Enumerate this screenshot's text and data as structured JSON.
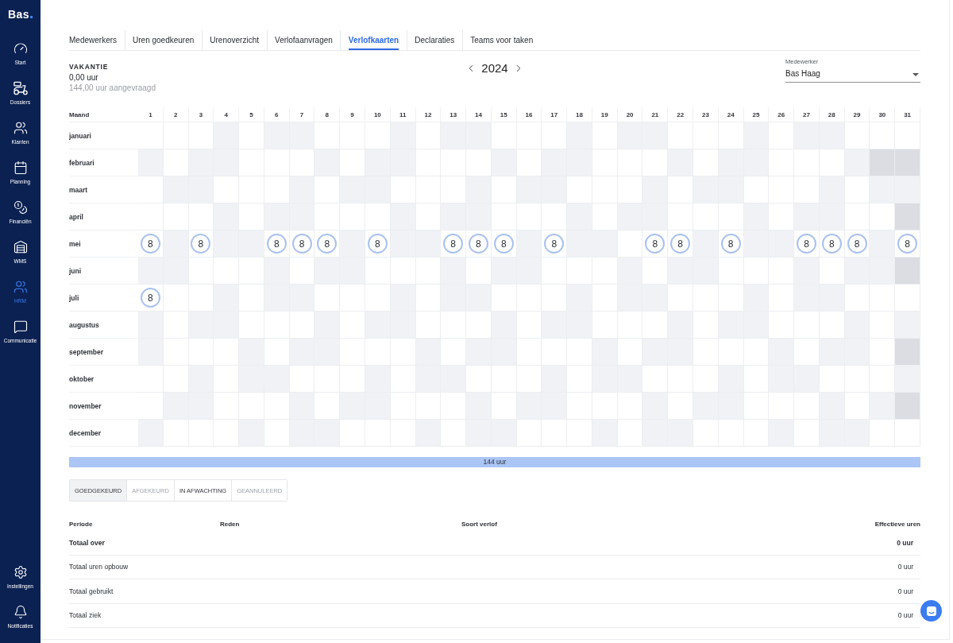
{
  "sidebar": {
    "logo": "Bas",
    "items": [
      {
        "label": "Start",
        "selected": false
      },
      {
        "label": "Dossiers",
        "selected": false
      },
      {
        "label": "Klanten",
        "selected": false
      },
      {
        "label": "Planning",
        "selected": false
      },
      {
        "label": "Financiën",
        "selected": false
      },
      {
        "label": "WMS",
        "selected": false
      },
      {
        "label": "HRM",
        "selected": true
      },
      {
        "label": "Communicatie",
        "selected": false
      }
    ],
    "bottom_items": [
      {
        "label": "Instellingen",
        "selected": false
      },
      {
        "label": "Notificaties",
        "selected": false
      }
    ]
  },
  "tabs": [
    {
      "label": "Medewerkers",
      "selected": false
    },
    {
      "label": "Uren goedkeuren",
      "selected": false
    },
    {
      "label": "Urenoverzicht",
      "selected": false
    },
    {
      "label": "Verlofaanvragen",
      "selected": false
    },
    {
      "label": "Verlofkaarten",
      "selected": true
    },
    {
      "label": "Declaraties",
      "selected": false
    },
    {
      "label": "Teams voor taken",
      "selected": false
    }
  ],
  "balance": {
    "title": "VAKANTIE",
    "hours": "0,00 uur",
    "requested": "144,00 uur aangevraagd"
  },
  "year_nav": {
    "year": "2024"
  },
  "employee_select": {
    "label": "Medewerker",
    "value": "Bas Haag"
  },
  "calendar": {
    "month_header": "Maand",
    "day_headers": [
      "1",
      "2",
      "3",
      "4",
      "5",
      "6",
      "7",
      "8",
      "9",
      "10",
      "11",
      "12",
      "13",
      "14",
      "15",
      "16",
      "17",
      "18",
      "19",
      "20",
      "21",
      "22",
      "23",
      "24",
      "25",
      "26",
      "27",
      "28",
      "29",
      "30",
      "31"
    ],
    "months": [
      {
        "name": "januari",
        "days": [
          {
            "kind": "work"
          },
          {
            "kind": "work"
          },
          {
            "kind": "work"
          },
          {
            "kind": "off"
          },
          {
            "kind": "work"
          },
          {
            "kind": "off"
          },
          {
            "kind": "off"
          },
          {
            "kind": "work"
          },
          {
            "kind": "work"
          },
          {
            "kind": "work"
          },
          {
            "kind": "off"
          },
          {
            "kind": "work"
          },
          {
            "kind": "off"
          },
          {
            "kind": "off"
          },
          {
            "kind": "work"
          },
          {
            "kind": "work"
          },
          {
            "kind": "work"
          },
          {
            "kind": "off"
          },
          {
            "kind": "work"
          },
          {
            "kind": "off"
          },
          {
            "kind": "off"
          },
          {
            "kind": "work"
          },
          {
            "kind": "work"
          },
          {
            "kind": "work"
          },
          {
            "kind": "off"
          },
          {
            "kind": "work"
          },
          {
            "kind": "off"
          },
          {
            "kind": "off"
          },
          {
            "kind": "work"
          },
          {
            "kind": "work"
          },
          {
            "kind": "work"
          }
        ]
      },
      {
        "name": "februari",
        "days": [
          {
            "kind": "off"
          },
          {
            "kind": "work"
          },
          {
            "kind": "off"
          },
          {
            "kind": "off"
          },
          {
            "kind": "work"
          },
          {
            "kind": "work"
          },
          {
            "kind": "work"
          },
          {
            "kind": "off"
          },
          {
            "kind": "work"
          },
          {
            "kind": "off"
          },
          {
            "kind": "off"
          },
          {
            "kind": "work"
          },
          {
            "kind": "work"
          },
          {
            "kind": "work"
          },
          {
            "kind": "off"
          },
          {
            "kind": "work"
          },
          {
            "kind": "off"
          },
          {
            "kind": "off"
          },
          {
            "kind": "work"
          },
          {
            "kind": "work"
          },
          {
            "kind": "work"
          },
          {
            "kind": "off"
          },
          {
            "kind": "work"
          },
          {
            "kind": "off"
          },
          {
            "kind": "off"
          },
          {
            "kind": "work"
          },
          {
            "kind": "work"
          },
          {
            "kind": "work"
          },
          {
            "kind": "off"
          },
          {
            "kind": "none"
          },
          {
            "kind": "none"
          }
        ]
      },
      {
        "name": "maart",
        "days": [
          {
            "kind": "work"
          },
          {
            "kind": "off"
          },
          {
            "kind": "off"
          },
          {
            "kind": "work"
          },
          {
            "kind": "work"
          },
          {
            "kind": "work"
          },
          {
            "kind": "off"
          },
          {
            "kind": "work"
          },
          {
            "kind": "off"
          },
          {
            "kind": "off"
          },
          {
            "kind": "work"
          },
          {
            "kind": "work"
          },
          {
            "kind": "work"
          },
          {
            "kind": "off"
          },
          {
            "kind": "work"
          },
          {
            "kind": "off"
          },
          {
            "kind": "off"
          },
          {
            "kind": "work"
          },
          {
            "kind": "work"
          },
          {
            "kind": "work"
          },
          {
            "kind": "off"
          },
          {
            "kind": "work"
          },
          {
            "kind": "off"
          },
          {
            "kind": "off"
          },
          {
            "kind": "work"
          },
          {
            "kind": "work"
          },
          {
            "kind": "work"
          },
          {
            "kind": "off"
          },
          {
            "kind": "work"
          },
          {
            "kind": "off"
          },
          {
            "kind": "off"
          }
        ]
      },
      {
        "name": "april",
        "days": [
          {
            "kind": "work"
          },
          {
            "kind": "work"
          },
          {
            "kind": "work"
          },
          {
            "kind": "off"
          },
          {
            "kind": "work"
          },
          {
            "kind": "off"
          },
          {
            "kind": "off"
          },
          {
            "kind": "work"
          },
          {
            "kind": "work"
          },
          {
            "kind": "work"
          },
          {
            "kind": "off"
          },
          {
            "kind": "work"
          },
          {
            "kind": "off"
          },
          {
            "kind": "off"
          },
          {
            "kind": "work"
          },
          {
            "kind": "work"
          },
          {
            "kind": "work"
          },
          {
            "kind": "off"
          },
          {
            "kind": "work"
          },
          {
            "kind": "off"
          },
          {
            "kind": "off"
          },
          {
            "kind": "work"
          },
          {
            "kind": "work"
          },
          {
            "kind": "work"
          },
          {
            "kind": "off"
          },
          {
            "kind": "work"
          },
          {
            "kind": "off"
          },
          {
            "kind": "off"
          },
          {
            "kind": "work"
          },
          {
            "kind": "work"
          },
          {
            "kind": "none"
          }
        ]
      },
      {
        "name": "mei",
        "days": [
          {
            "kind": "work",
            "hours": "8"
          },
          {
            "kind": "off"
          },
          {
            "kind": "work",
            "hours": "8"
          },
          {
            "kind": "off"
          },
          {
            "kind": "off"
          },
          {
            "kind": "work",
            "hours": "8"
          },
          {
            "kind": "work",
            "hours": "8"
          },
          {
            "kind": "work",
            "hours": "8"
          },
          {
            "kind": "off"
          },
          {
            "kind": "work",
            "hours": "8"
          },
          {
            "kind": "off"
          },
          {
            "kind": "off"
          },
          {
            "kind": "work",
            "hours": "8"
          },
          {
            "kind": "work",
            "hours": "8"
          },
          {
            "kind": "work",
            "hours": "8"
          },
          {
            "kind": "off"
          },
          {
            "kind": "work",
            "hours": "8"
          },
          {
            "kind": "off"
          },
          {
            "kind": "off"
          },
          {
            "kind": "work"
          },
          {
            "kind": "work",
            "hours": "8"
          },
          {
            "kind": "work",
            "hours": "8"
          },
          {
            "kind": "off"
          },
          {
            "kind": "work",
            "hours": "8"
          },
          {
            "kind": "off"
          },
          {
            "kind": "off"
          },
          {
            "kind": "work",
            "hours": "8"
          },
          {
            "kind": "work",
            "hours": "8"
          },
          {
            "kind": "work",
            "hours": "8"
          },
          {
            "kind": "off"
          },
          {
            "kind": "work",
            "hours": "8"
          }
        ]
      },
      {
        "name": "juni",
        "days": [
          {
            "kind": "off"
          },
          {
            "kind": "off"
          },
          {
            "kind": "work"
          },
          {
            "kind": "work"
          },
          {
            "kind": "work"
          },
          {
            "kind": "off"
          },
          {
            "kind": "work"
          },
          {
            "kind": "off"
          },
          {
            "kind": "off"
          },
          {
            "kind": "work"
          },
          {
            "kind": "work"
          },
          {
            "kind": "work"
          },
          {
            "kind": "off"
          },
          {
            "kind": "work"
          },
          {
            "kind": "off"
          },
          {
            "kind": "off"
          },
          {
            "kind": "work"
          },
          {
            "kind": "work"
          },
          {
            "kind": "work"
          },
          {
            "kind": "off"
          },
          {
            "kind": "work"
          },
          {
            "kind": "off"
          },
          {
            "kind": "off"
          },
          {
            "kind": "work"
          },
          {
            "kind": "work"
          },
          {
            "kind": "work"
          },
          {
            "kind": "off"
          },
          {
            "kind": "work"
          },
          {
            "kind": "off"
          },
          {
            "kind": "off"
          },
          {
            "kind": "none"
          }
        ]
      },
      {
        "name": "juli",
        "days": [
          {
            "kind": "work",
            "hours": "8"
          },
          {
            "kind": "work"
          },
          {
            "kind": "work"
          },
          {
            "kind": "off"
          },
          {
            "kind": "work"
          },
          {
            "kind": "off"
          },
          {
            "kind": "off"
          },
          {
            "kind": "work"
          },
          {
            "kind": "work"
          },
          {
            "kind": "work"
          },
          {
            "kind": "off"
          },
          {
            "kind": "work"
          },
          {
            "kind": "off"
          },
          {
            "kind": "off"
          },
          {
            "kind": "work"
          },
          {
            "kind": "work"
          },
          {
            "kind": "work"
          },
          {
            "kind": "off"
          },
          {
            "kind": "work"
          },
          {
            "kind": "off"
          },
          {
            "kind": "off"
          },
          {
            "kind": "work"
          },
          {
            "kind": "work"
          },
          {
            "kind": "work"
          },
          {
            "kind": "off"
          },
          {
            "kind": "work"
          },
          {
            "kind": "off"
          },
          {
            "kind": "off"
          },
          {
            "kind": "work"
          },
          {
            "kind": "work"
          },
          {
            "kind": "work"
          }
        ]
      },
      {
        "name": "augustus",
        "days": [
          {
            "kind": "off"
          },
          {
            "kind": "work"
          },
          {
            "kind": "off"
          },
          {
            "kind": "off"
          },
          {
            "kind": "work"
          },
          {
            "kind": "work"
          },
          {
            "kind": "work"
          },
          {
            "kind": "off"
          },
          {
            "kind": "work"
          },
          {
            "kind": "off"
          },
          {
            "kind": "off"
          },
          {
            "kind": "work"
          },
          {
            "kind": "work"
          },
          {
            "kind": "work"
          },
          {
            "kind": "off"
          },
          {
            "kind": "work"
          },
          {
            "kind": "off"
          },
          {
            "kind": "off"
          },
          {
            "kind": "work"
          },
          {
            "kind": "work"
          },
          {
            "kind": "work"
          },
          {
            "kind": "off"
          },
          {
            "kind": "work"
          },
          {
            "kind": "off"
          },
          {
            "kind": "off"
          },
          {
            "kind": "work"
          },
          {
            "kind": "work"
          },
          {
            "kind": "work"
          },
          {
            "kind": "off"
          },
          {
            "kind": "work"
          },
          {
            "kind": "off"
          }
        ]
      },
      {
        "name": "september",
        "days": [
          {
            "kind": "off"
          },
          {
            "kind": "work"
          },
          {
            "kind": "work"
          },
          {
            "kind": "work"
          },
          {
            "kind": "off"
          },
          {
            "kind": "work"
          },
          {
            "kind": "off"
          },
          {
            "kind": "off"
          },
          {
            "kind": "work"
          },
          {
            "kind": "work"
          },
          {
            "kind": "work"
          },
          {
            "kind": "off"
          },
          {
            "kind": "work"
          },
          {
            "kind": "off"
          },
          {
            "kind": "off"
          },
          {
            "kind": "work"
          },
          {
            "kind": "work"
          },
          {
            "kind": "work"
          },
          {
            "kind": "off"
          },
          {
            "kind": "work"
          },
          {
            "kind": "off"
          },
          {
            "kind": "off"
          },
          {
            "kind": "work"
          },
          {
            "kind": "work"
          },
          {
            "kind": "work"
          },
          {
            "kind": "off"
          },
          {
            "kind": "work"
          },
          {
            "kind": "off"
          },
          {
            "kind": "off"
          },
          {
            "kind": "work"
          },
          {
            "kind": "none"
          }
        ]
      },
      {
        "name": "oktober",
        "days": [
          {
            "kind": "work"
          },
          {
            "kind": "work"
          },
          {
            "kind": "off"
          },
          {
            "kind": "work"
          },
          {
            "kind": "off"
          },
          {
            "kind": "off"
          },
          {
            "kind": "work"
          },
          {
            "kind": "work"
          },
          {
            "kind": "work"
          },
          {
            "kind": "off"
          },
          {
            "kind": "work"
          },
          {
            "kind": "off"
          },
          {
            "kind": "off"
          },
          {
            "kind": "work"
          },
          {
            "kind": "work"
          },
          {
            "kind": "work"
          },
          {
            "kind": "off"
          },
          {
            "kind": "work"
          },
          {
            "kind": "off"
          },
          {
            "kind": "off"
          },
          {
            "kind": "work"
          },
          {
            "kind": "work"
          },
          {
            "kind": "work"
          },
          {
            "kind": "off"
          },
          {
            "kind": "work"
          },
          {
            "kind": "off"
          },
          {
            "kind": "off"
          },
          {
            "kind": "work"
          },
          {
            "kind": "work"
          },
          {
            "kind": "work"
          },
          {
            "kind": "off"
          }
        ]
      },
      {
        "name": "november",
        "days": [
          {
            "kind": "work"
          },
          {
            "kind": "off"
          },
          {
            "kind": "off"
          },
          {
            "kind": "work"
          },
          {
            "kind": "work"
          },
          {
            "kind": "work"
          },
          {
            "kind": "off"
          },
          {
            "kind": "work"
          },
          {
            "kind": "off"
          },
          {
            "kind": "off"
          },
          {
            "kind": "work"
          },
          {
            "kind": "work"
          },
          {
            "kind": "work"
          },
          {
            "kind": "off"
          },
          {
            "kind": "work"
          },
          {
            "kind": "off"
          },
          {
            "kind": "off"
          },
          {
            "kind": "work"
          },
          {
            "kind": "work"
          },
          {
            "kind": "work"
          },
          {
            "kind": "off"
          },
          {
            "kind": "work"
          },
          {
            "kind": "off"
          },
          {
            "kind": "off"
          },
          {
            "kind": "work"
          },
          {
            "kind": "work"
          },
          {
            "kind": "work"
          },
          {
            "kind": "off"
          },
          {
            "kind": "work"
          },
          {
            "kind": "off"
          },
          {
            "kind": "none"
          }
        ]
      },
      {
        "name": "december",
        "days": [
          {
            "kind": "off"
          },
          {
            "kind": "work"
          },
          {
            "kind": "work"
          },
          {
            "kind": "work"
          },
          {
            "kind": "off"
          },
          {
            "kind": "work"
          },
          {
            "kind": "off"
          },
          {
            "kind": "off"
          },
          {
            "kind": "work"
          },
          {
            "kind": "work"
          },
          {
            "kind": "work"
          },
          {
            "kind": "off"
          },
          {
            "kind": "work"
          },
          {
            "kind": "off"
          },
          {
            "kind": "off"
          },
          {
            "kind": "work"
          },
          {
            "kind": "work"
          },
          {
            "kind": "work"
          },
          {
            "kind": "off"
          },
          {
            "kind": "work"
          },
          {
            "kind": "off"
          },
          {
            "kind": "off"
          },
          {
            "kind": "work"
          },
          {
            "kind": "work"
          },
          {
            "kind": "work"
          },
          {
            "kind": "off"
          },
          {
            "kind": "work"
          },
          {
            "kind": "off"
          },
          {
            "kind": "off"
          },
          {
            "kind": "work"
          },
          {
            "kind": "work"
          }
        ]
      }
    ]
  },
  "total_bar": {
    "text": "144 uur"
  },
  "filters": [
    {
      "label": "GOEDGEKEURD",
      "selected": true,
      "disabled": false
    },
    {
      "label": "AFGEKEURD",
      "selected": false,
      "disabled": true
    },
    {
      "label": "IN AFWACHTING",
      "selected": false,
      "disabled": false
    },
    {
      "label": "GEANNULEERD",
      "selected": false,
      "disabled": true
    }
  ],
  "summary_table": {
    "columns": [
      "Periode",
      "Reden",
      "Soort verlof",
      "Effectieve uren"
    ],
    "rows": [
      {
        "label": "Totaal over",
        "value": "0 uur",
        "bold": true
      },
      {
        "label": "Totaal uren opbouw",
        "value": "0 uur",
        "bold": false
      },
      {
        "label": "Totaal gebruikt",
        "value": "0 uur",
        "bold": false
      },
      {
        "label": "Totaal ziek",
        "value": "0 uur",
        "bold": false
      }
    ]
  }
}
